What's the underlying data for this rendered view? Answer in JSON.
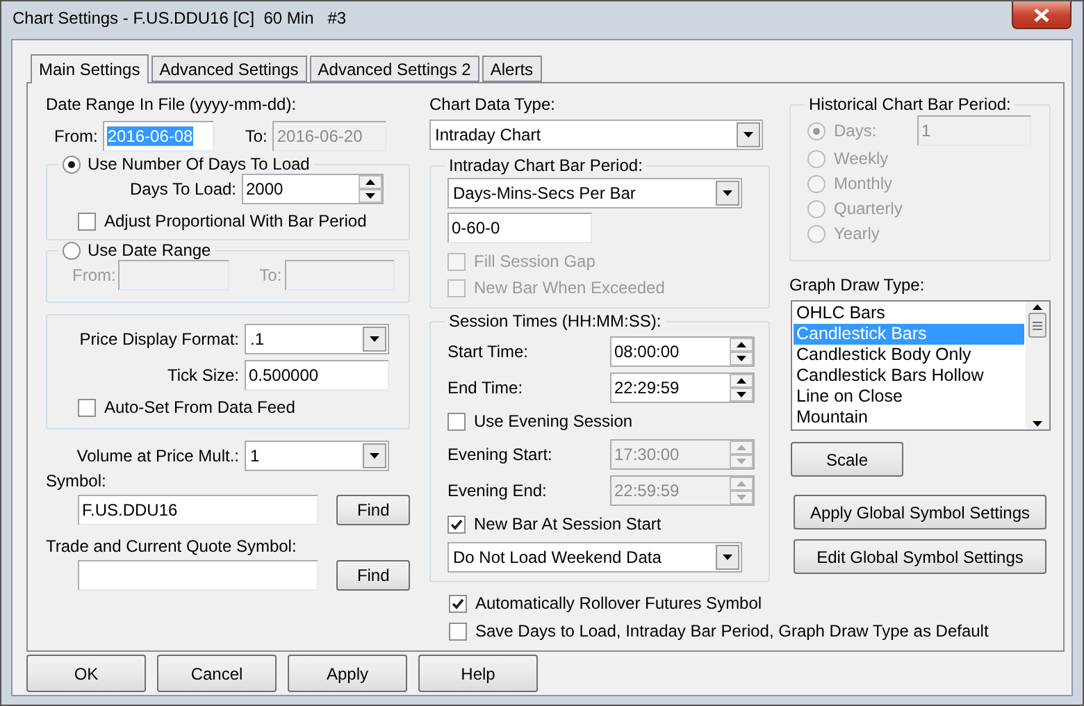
{
  "window": {
    "title": "Chart Settings - F.US.DDU16 [C]  60 Min   #3"
  },
  "tabs": [
    {
      "label": "Main Settings",
      "selected": true
    },
    {
      "label": "Advanced Settings",
      "selected": false
    },
    {
      "label": "Advanced Settings 2",
      "selected": false
    },
    {
      "label": "Alerts",
      "selected": false
    }
  ],
  "date_range": {
    "label": "Date Range In File (yyyy-mm-dd):",
    "from_label": "From:",
    "from_value": "2016-06-08",
    "from_text_selected": true,
    "to_label": "To:",
    "to_value": "2016-06-20"
  },
  "days_group": {
    "label": "Use Number Of Days To Load",
    "selected": true,
    "days_label": "Days To Load:",
    "days_value": "2000",
    "adjust": {
      "label": "Adjust Proportional With Bar Period",
      "checked": false
    }
  },
  "date_group": {
    "label": "Use Date Range",
    "selected": false,
    "disabled": true,
    "from_label": "From:",
    "to_label": "To:"
  },
  "price_group": {
    "format_label": "Price Display Format:",
    "format_value": ".1",
    "tick_label": "Tick Size:",
    "tick_value": "0.500000",
    "autoset": {
      "label": "Auto-Set From Data Feed",
      "checked": false
    }
  },
  "volume": {
    "label": "Volume at Price Mult.:",
    "value": "1"
  },
  "symbol": {
    "label": "Symbol:",
    "value": "F.US.DDU16",
    "button": "Find"
  },
  "quote_symbol": {
    "label": "Trade and Current Quote Symbol:",
    "button": "Find"
  },
  "chart_data_type": {
    "label": "Chart Data Type:",
    "value": "Intraday Chart"
  },
  "bar_period": {
    "label": "Intraday Chart Bar Period:",
    "unit_value": "Days-Mins-Secs Per Bar",
    "period_value": "0-60-0",
    "options": [
      {
        "label": "Fill Session Gap",
        "checked": false,
        "disabled": true
      },
      {
        "label": "New Bar When Exceeded",
        "checked": false,
        "disabled": true
      }
    ]
  },
  "session": {
    "label": "Session Times (HH:MM:SS):",
    "rows": [
      {
        "kind": "time",
        "label": "Start Time:",
        "value": "08:00:00",
        "disabled": false
      },
      {
        "kind": "time",
        "label": "End Time:",
        "value": "22:29:59",
        "disabled": false
      },
      {
        "kind": "checkbox",
        "label": "Use Evening Session",
        "checked": false
      },
      {
        "kind": "time",
        "label": "Evening Start:",
        "value": "17:30:00",
        "disabled": true
      },
      {
        "kind": "time",
        "label": "Evening End:",
        "value": "22:59:59",
        "disabled": true
      },
      {
        "kind": "checkbox",
        "label": "New Bar At Session Start",
        "checked": true
      },
      {
        "kind": "select",
        "value": "Do Not Load Weekend Data"
      }
    ]
  },
  "bottom_options": [
    {
      "label": "Automatically Rollover Futures Symbol",
      "checked": true
    },
    {
      "label": "Save Days to Load, Intraday Bar Period, Graph Draw Type as Default",
      "checked": false
    }
  ],
  "historical": {
    "label": "Historical Chart Bar Period:",
    "disabled": true,
    "days_value": "1",
    "options": [
      {
        "label": "Days:",
        "selected": true
      },
      {
        "label": "Weekly",
        "selected": false
      },
      {
        "label": "Monthly",
        "selected": false
      },
      {
        "label": "Quarterly",
        "selected": false
      },
      {
        "label": "Yearly",
        "selected": false
      }
    ]
  },
  "graph_draw_type": {
    "label": "Graph Draw Type:",
    "items": [
      {
        "label": "OHLC Bars",
        "selected": false
      },
      {
        "label": "Candlestick Bars",
        "selected": true
      },
      {
        "label": "Candlestick Body Only",
        "selected": false
      },
      {
        "label": "Candlestick Bars Hollow",
        "selected": false
      },
      {
        "label": "Line on Close",
        "selected": false
      },
      {
        "label": "Mountain",
        "selected": false
      }
    ]
  },
  "scale_button": "Scale",
  "global_buttons": [
    "Apply Global Symbol Settings",
    "Edit Global Symbol Settings"
  ],
  "footer_buttons": [
    "OK",
    "Cancel",
    "Apply",
    "Help"
  ]
}
